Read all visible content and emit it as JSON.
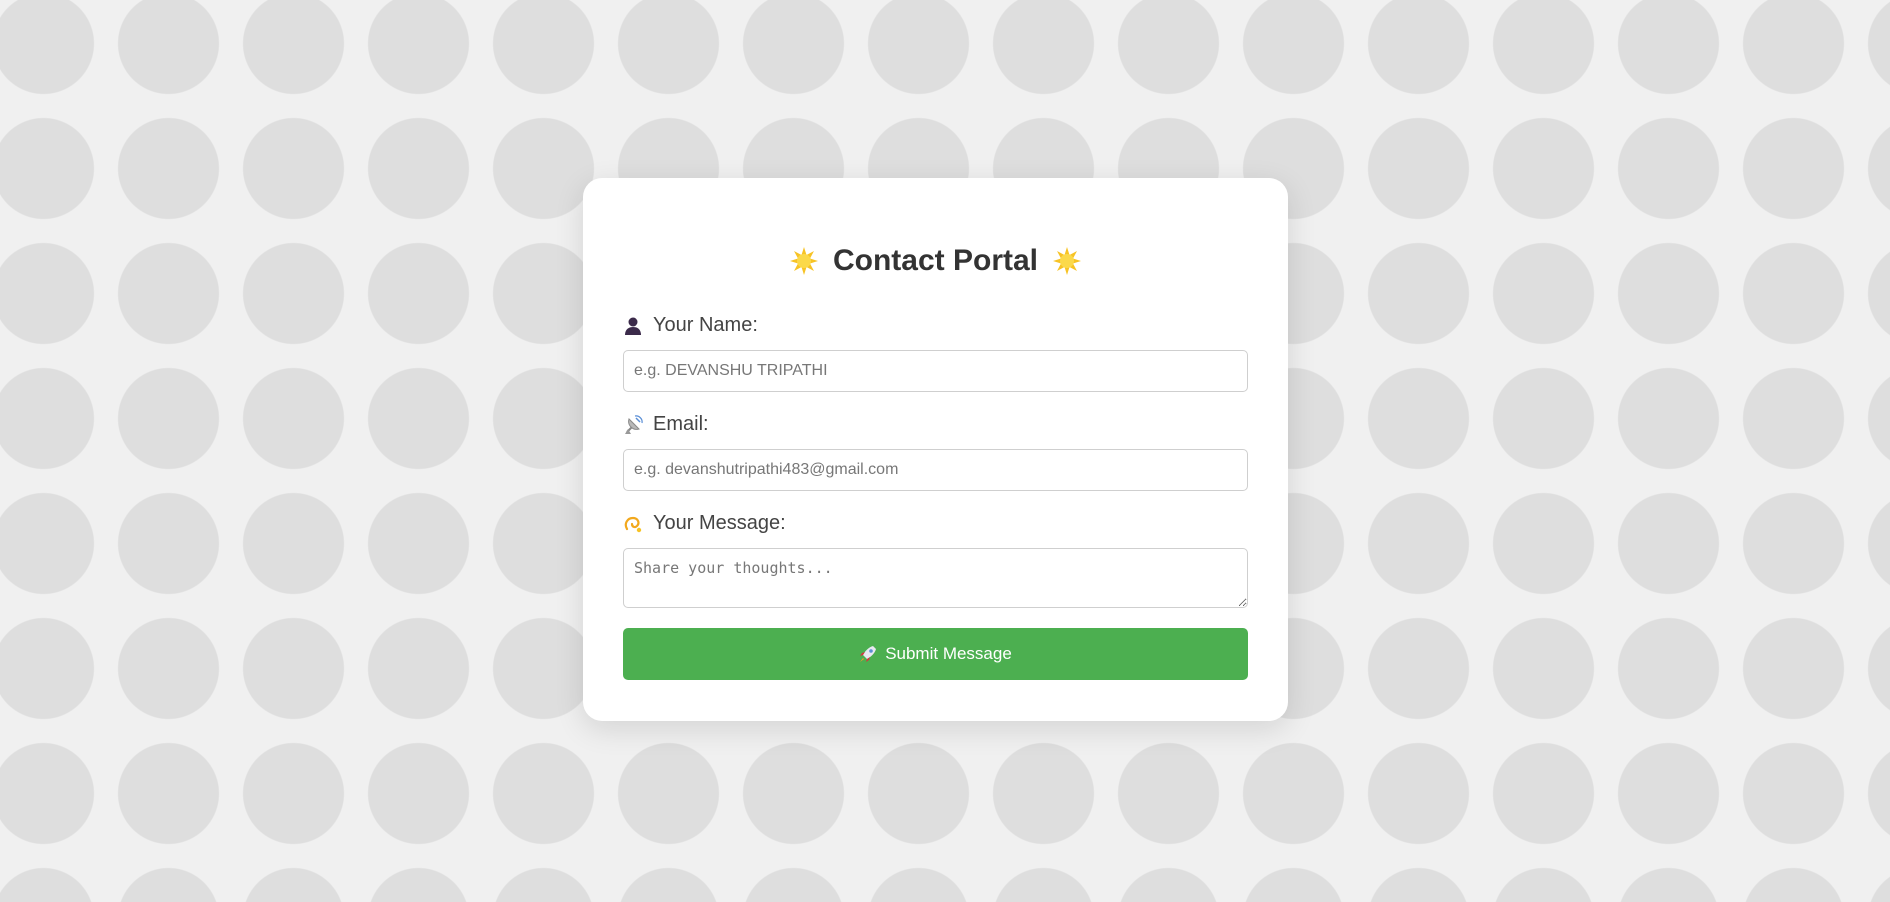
{
  "form": {
    "title": "Contact Portal",
    "title_icon": "glowing-star-icon",
    "name_label": "Your Name:",
    "name_icon": "person-silhouette-icon",
    "name_placeholder": "e.g. DEVANSHU TRIPATHI",
    "email_label": "Email:",
    "email_icon": "satellite-antenna-icon",
    "email_placeholder": "e.g. devanshutripathi483@gmail.com",
    "message_label": "Your Message:",
    "message_icon": "dizzy-swirl-icon",
    "message_placeholder": "Share your thoughts...",
    "submit_label": "Submit Message",
    "submit_icon": "rocket-icon"
  },
  "colors": {
    "background": "#f0f0f0",
    "dots": "#dedede",
    "card": "#ffffff",
    "submit_button": "#4caf50",
    "title_text": "#333333",
    "star": "#f7c325"
  }
}
